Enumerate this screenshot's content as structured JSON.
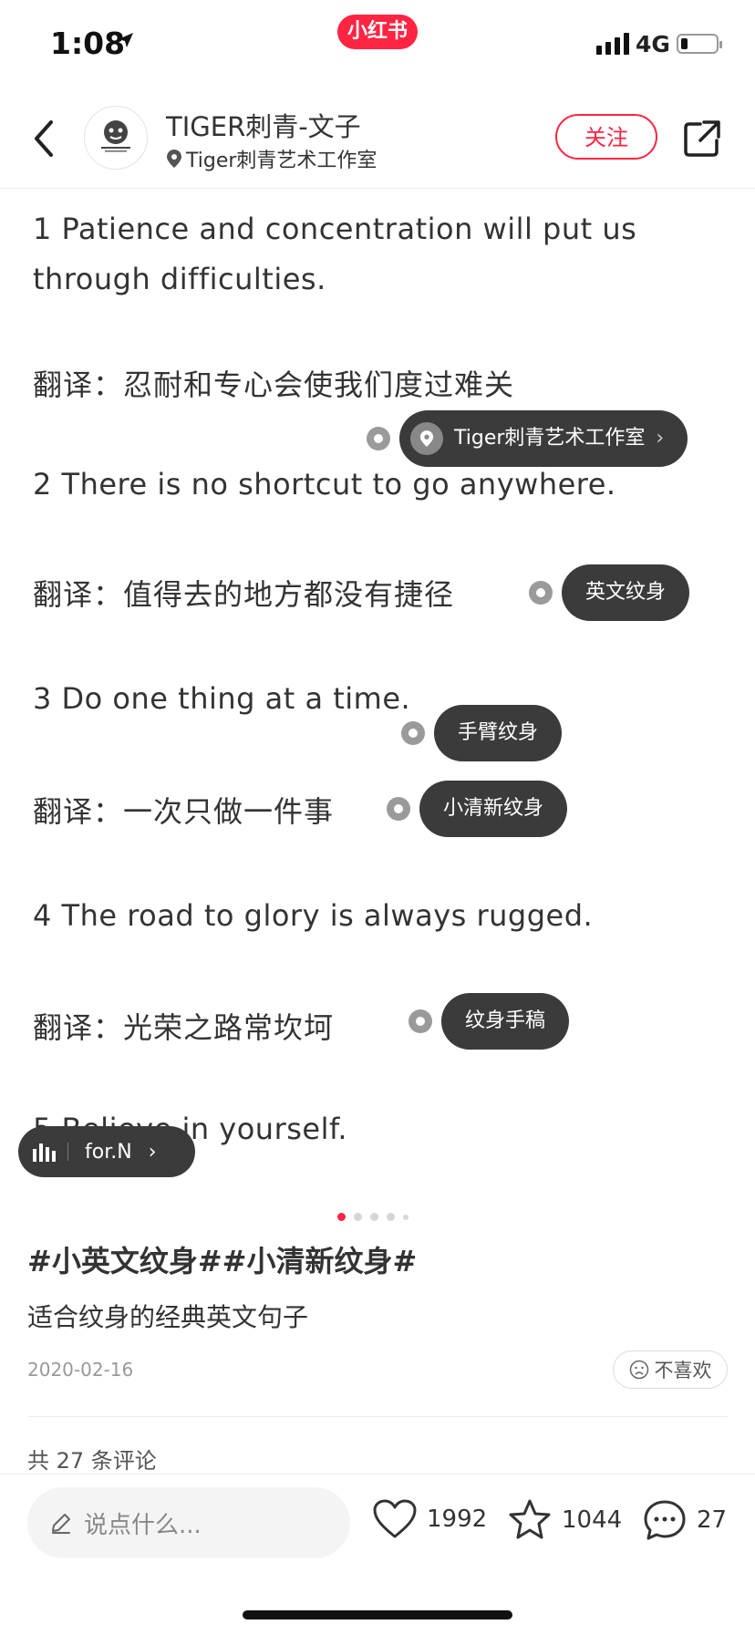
{
  "status_bar": {
    "time": "1:08",
    "network": "4G",
    "app_badge": "小红书"
  },
  "header": {
    "author_name": "TIGER刺青-文子",
    "location": "Tiger刺青艺术工作室",
    "follow_label": "关注",
    "avatar_text": "TIGER TATTOO"
  },
  "note": {
    "lines": [
      "1 Patience and concentration will put us",
      "through difficulties.",
      "翻译：忍耐和专心会使我们度过难关",
      "2 There is no shortcut to go anywhere.",
      "翻译：值得去的地方都没有捷径",
      "3 Do one thing at a time.",
      "翻译：一次只做一件事",
      "4 The road to glory is always rugged.",
      "翻译：光荣之路常坎坷",
      "5 Believe in yourself."
    ],
    "tags": {
      "location_tag": "Tiger刺青艺术工作室",
      "tag_english": "英文纹身",
      "tag_arm": "手臂纹身",
      "tag_fresh": "小清新纹身",
      "tag_draft": "纹身手稿"
    },
    "music_label": "for.N",
    "image_count": 5,
    "active_index": 0
  },
  "content": {
    "hashtags": "#小英文纹身##小清新纹身#",
    "description": "适合纹身的经典英文句子",
    "date": "2020-02-16",
    "dislike_label": "不喜欢",
    "comment_count_label": "共 27 条评论"
  },
  "bottom_bar": {
    "input_placeholder": "说点什么...",
    "likes": "1992",
    "collects": "1044",
    "comments": "27"
  },
  "colors": {
    "brand": "#ff2442",
    "tag_bg": "#3b3b3b"
  }
}
